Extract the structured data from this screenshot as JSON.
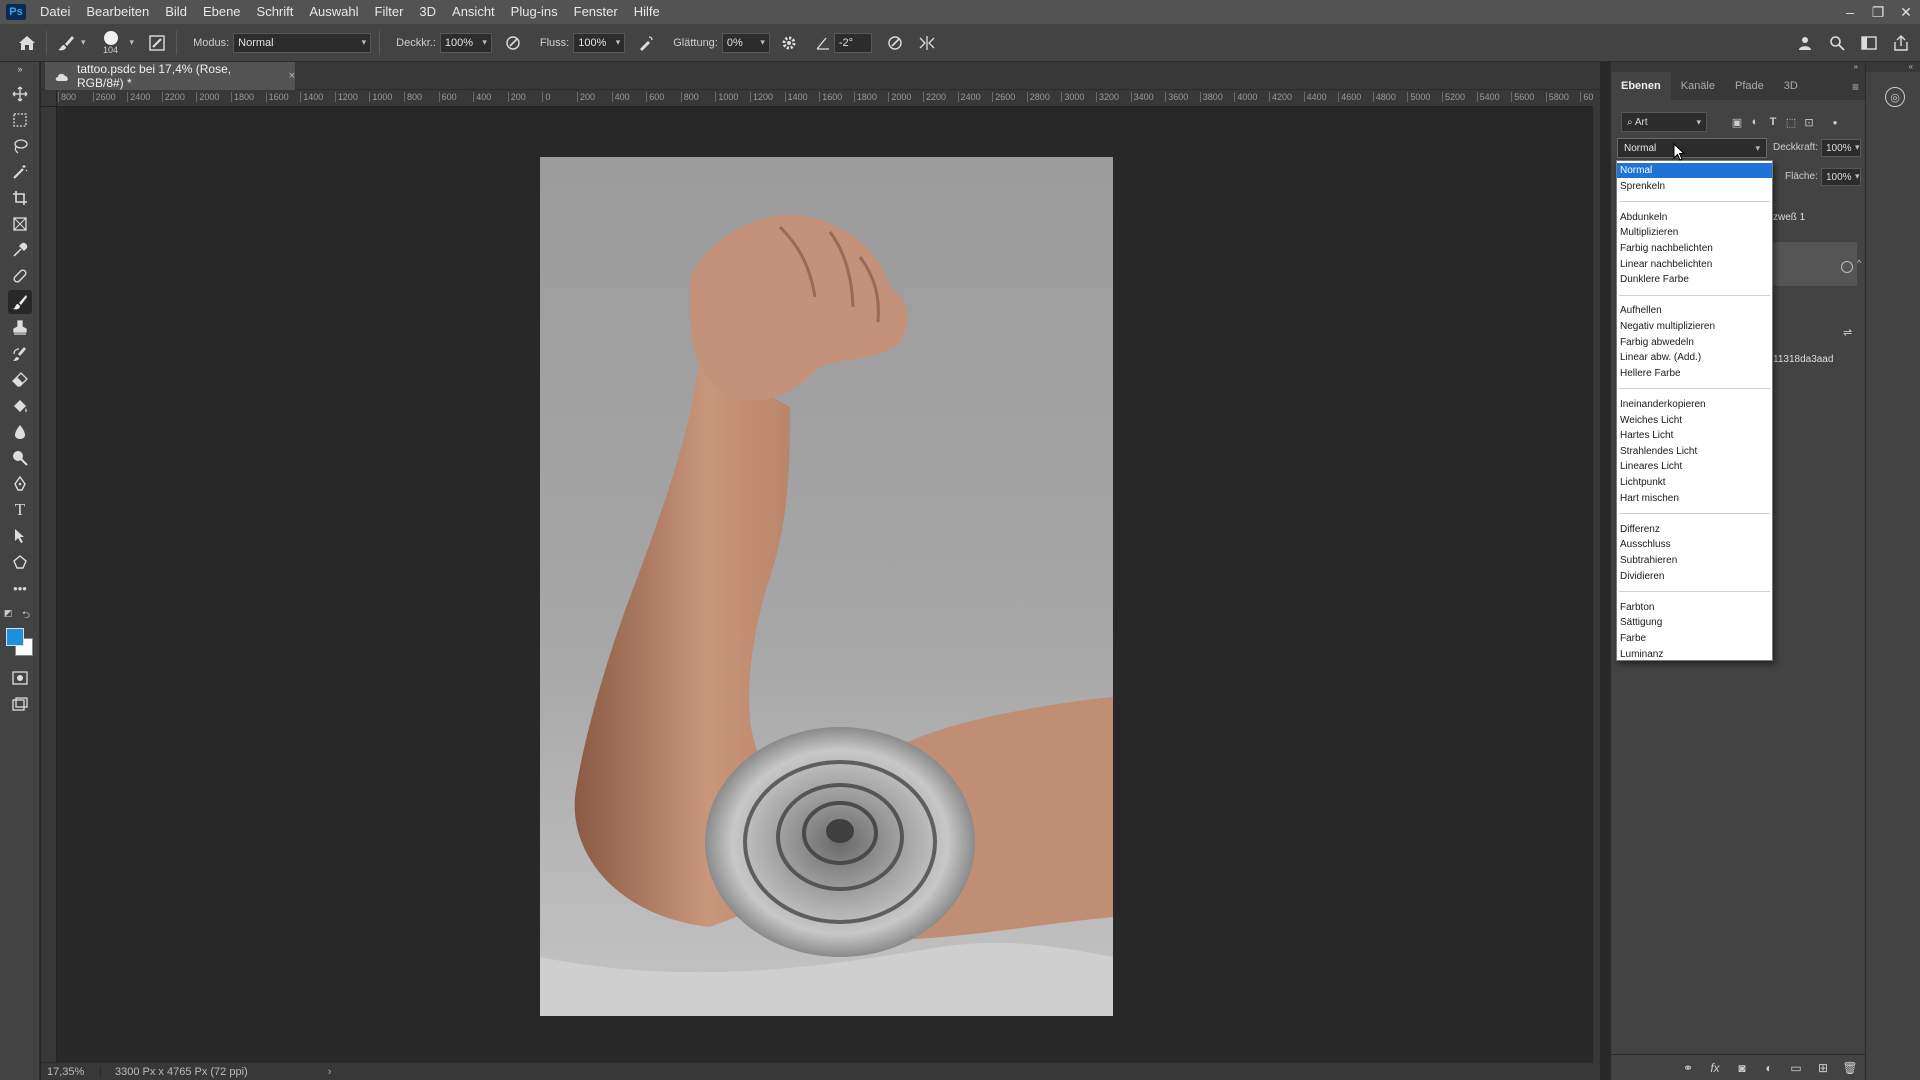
{
  "app": {
    "logo": "Ps",
    "menu": [
      "Datei",
      "Bearbeiten",
      "Bild",
      "Ebene",
      "Schrift",
      "Auswahl",
      "Filter",
      "3D",
      "Ansicht",
      "Plug-ins",
      "Fenster",
      "Hilfe"
    ],
    "window_controls": [
      "–",
      "❐",
      "✕"
    ]
  },
  "options": {
    "brush_size": "104",
    "modus_label": "Modus:",
    "modus_value": "Normal",
    "deckkraft_label": "Deckkr.:",
    "deckkraft_value": "100%",
    "fluss_label": "Fluss:",
    "fluss_value": "100%",
    "glaettung_label": "Glättung:",
    "glaettung_value": "0%",
    "angle_value": "-2°"
  },
  "document": {
    "tab_title": "tattoo.psdc bei 17,4% (Rose, RGB/8#) *",
    "tab_close": "×"
  },
  "ruler": {
    "top_labels": [
      "800",
      "2600",
      "2400",
      "2200",
      "2000",
      "1800",
      "1600",
      "1400",
      "1200",
      "1000",
      "800",
      "600",
      "400",
      "200",
      "0",
      "200",
      "400",
      "600",
      "800",
      "1000",
      "1200",
      "1400",
      "1600",
      "1800",
      "2000",
      "2200",
      "2400",
      "2600",
      "2800",
      "3000",
      "3200",
      "3400",
      "3600",
      "3800",
      "4000",
      "4200",
      "4400",
      "4600",
      "4800",
      "5000",
      "5200",
      "5400",
      "5600",
      "5800",
      "60"
    ]
  },
  "status": {
    "zoom": "17,35%",
    "doc_info": "3300 Px x 4765 Px (72 ppi)",
    "arrow": "›"
  },
  "layers_panel": {
    "tabs": [
      "Ebenen",
      "Kanäle",
      "Pfade",
      "3D"
    ],
    "filter_label": "Art",
    "blend_mode": "Normal",
    "opacity_label": "Deckkraft:",
    "opacity_value": "100%",
    "fill_label": "Fläche:",
    "fill_value": "100%",
    "layer_name_partial_1": "zweß 1",
    "layer_name_partial_2": "11318da3aad"
  },
  "blend_dropdown": {
    "groups": [
      [
        "Normal",
        "Sprenkeln"
      ],
      [
        "Abdunkeln",
        "Multiplizieren",
        "Farbig nachbelichten",
        "Linear nachbelichten",
        "Dunklere Farbe"
      ],
      [
        "Aufhellen",
        "Negativ multiplizieren",
        "Farbig abwedeln",
        "Linear abw. (Add.)",
        "Hellere Farbe"
      ],
      [
        "Ineinanderkopieren",
        "Weiches Licht",
        "Hartes Licht",
        "Strahlendes Licht",
        "Lineares Licht",
        "Lichtpunkt",
        "Hart mischen"
      ],
      [
        "Differenz",
        "Ausschluss",
        "Subtrahieren",
        "Dividieren"
      ],
      [
        "Farbton",
        "Sättigung",
        "Farbe",
        "Luminanz"
      ]
    ],
    "selected": "Normal"
  },
  "colors": {
    "foreground": "#1e90e0",
    "background": "#ffffff",
    "selection": "#1f73d6"
  }
}
